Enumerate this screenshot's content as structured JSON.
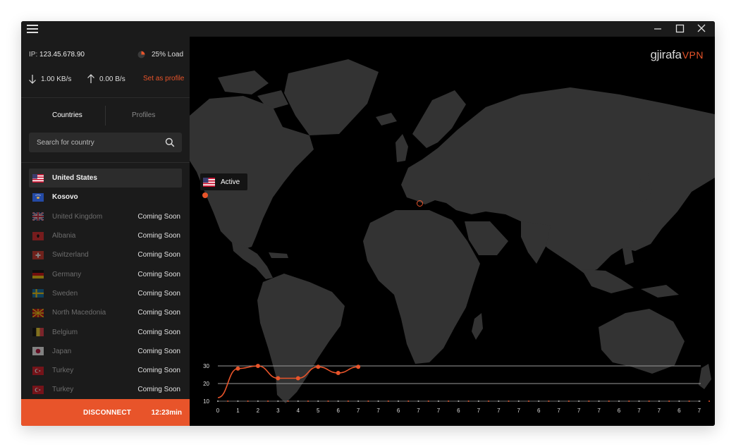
{
  "status": {
    "ip_label": "IP:",
    "ip": "123.45.678.90",
    "load": "25% Load",
    "download": "1.00 KB/s",
    "upload": "0.00 B/s",
    "set_profile": "Set as profile"
  },
  "tabs": [
    {
      "label": "Countries",
      "active": true
    },
    {
      "label": "Profiles",
      "active": false
    }
  ],
  "search": {
    "placeholder": "Search for country"
  },
  "countries": [
    {
      "name": "United States",
      "status": "",
      "enabled": true,
      "selected": true
    },
    {
      "name": "Kosovo",
      "status": "",
      "enabled": true,
      "selected": false
    },
    {
      "name": "United Kingdom",
      "status": "Coming Soon",
      "enabled": false
    },
    {
      "name": "Albania",
      "status": "Coming Soon",
      "enabled": false
    },
    {
      "name": "Switzerland",
      "status": "Coming Soon",
      "enabled": false
    },
    {
      "name": "Germany",
      "status": "Coming Soon",
      "enabled": false
    },
    {
      "name": "Sweden",
      "status": "Coming Soon",
      "enabled": false
    },
    {
      "name": "North Macedonia",
      "status": "Coming Soon",
      "enabled": false
    },
    {
      "name": "Belgium",
      "status": "Coming Soon",
      "enabled": false
    },
    {
      "name": "Japan",
      "status": "Coming Soon",
      "enabled": false
    },
    {
      "name": "Turkey",
      "status": "Coming Soon",
      "enabled": false
    },
    {
      "name": "Turkey",
      "status": "Coming Soon",
      "enabled": false
    }
  ],
  "connection": {
    "disconnect_label": "DISCONNECT",
    "timer": "12:23min"
  },
  "map": {
    "brand_main": "gjirafa",
    "brand_accent": "VPN",
    "active_label": "Active"
  },
  "colors": {
    "accent": "#e8542a",
    "sidebar_bg": "#1b1b1b",
    "map_bg": "#000000",
    "land": "#333333"
  },
  "chart_data": {
    "type": "line",
    "x_tick_labels": [
      "0",
      "1",
      "2",
      "3",
      "4",
      "5",
      "6",
      "7",
      "7",
      "6",
      "7",
      "7",
      "6",
      "7",
      "7",
      "7",
      "6",
      "7",
      "7",
      "7",
      "6",
      "7",
      "7",
      "6",
      "7",
      "7"
    ],
    "y_ticks": [
      10,
      20,
      30
    ],
    "ylim": [
      10,
      30
    ],
    "values": [
      12,
      28.5,
      30,
      23,
      23,
      29.5,
      26,
      29.5
    ]
  }
}
